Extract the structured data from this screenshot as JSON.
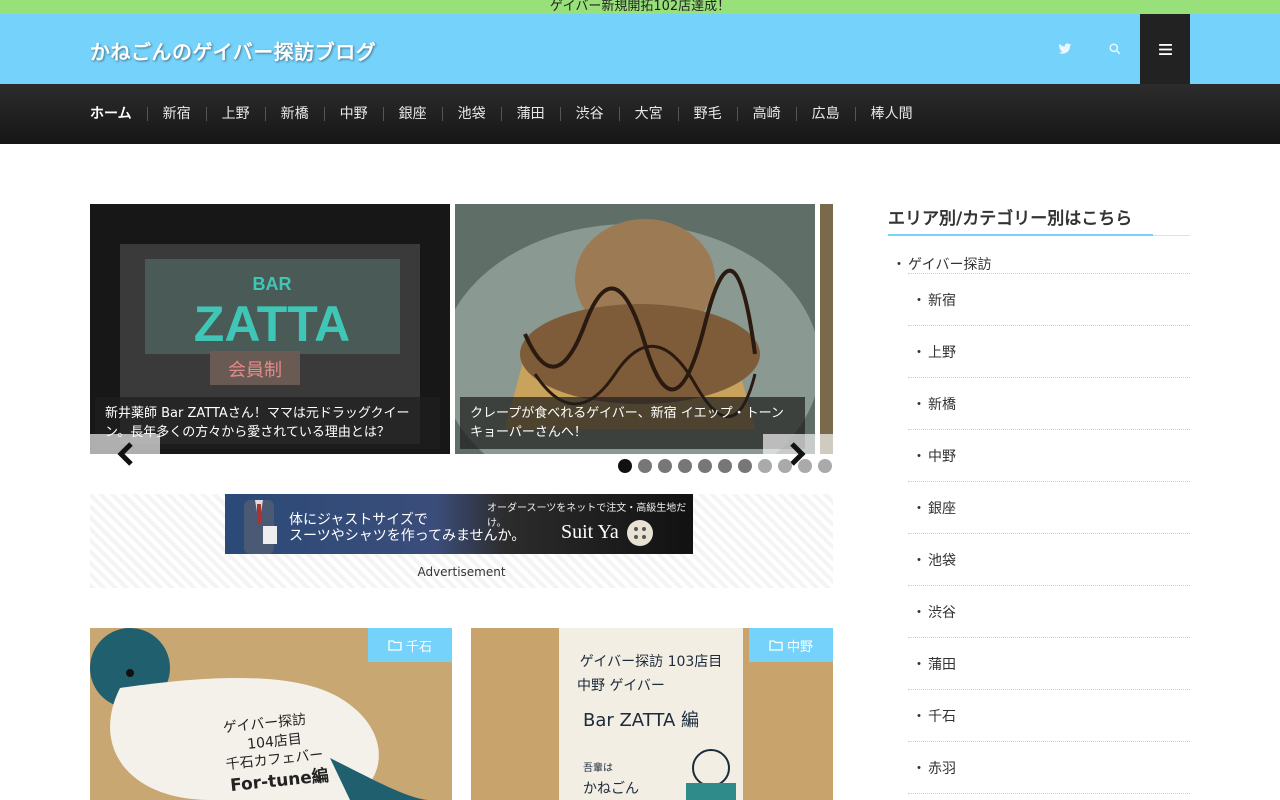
{
  "notice": {
    "text": "ゲイバー新規開拓102店達成！"
  },
  "header": {
    "site_title": "かねごんのゲイバー探訪ブログ",
    "icons": [
      "twitter-icon",
      "search-icon",
      "menu-icon"
    ]
  },
  "nav": {
    "items": [
      "ホーム",
      "新宿",
      "上野",
      "新橋",
      "中野",
      "銀座",
      "池袋",
      "蒲田",
      "渋谷",
      "大宮",
      "野毛",
      "高崎",
      "広島",
      "棒人間"
    ]
  },
  "slider": {
    "slides": [
      {
        "caption": "新井薬師 Bar ZATTAさん！ママは元ドラッグクイーン。長年多くの方々から愛されている理由とは？",
        "sign_top": "BAR",
        "sign_main": "ZATTA",
        "sign_sub": "会員制"
      },
      {
        "caption": "クレープが食べれるゲイバー、新宿 イエップ・トーンキョーパーさんへ！"
      }
    ],
    "dots": 11,
    "active_dot": 1
  },
  "ad": {
    "line1": "体にジャストサイズで",
    "line2": "スーツやシャツを作ってみませんか。",
    "top_text": "オーダースーツをネットで注文・高級生地だけ。",
    "brand": "Suit Ya",
    "label": "Advertisement"
  },
  "posts": [
    {
      "category": "千石",
      "card_lines": [
        "ゲイバー探訪",
        "104店目",
        "千石カフェバー",
        "For-tune編"
      ]
    },
    {
      "category": "中野",
      "card_lines": [
        "ゲイバー探訪 103店目",
        "中野 ゲイバー",
        "Bar ZATTA 編",
        "吾輩は",
        "かねごん"
      ]
    }
  ],
  "sidebar": {
    "title": "エリア別/カテゴリー別はこちら",
    "parent": "ゲイバー探訪",
    "children": [
      "新宿",
      "上野",
      "新橋",
      "中野",
      "銀座",
      "池袋",
      "渋谷",
      "蒲田",
      "千石",
      "赤羽"
    ]
  },
  "colors": {
    "accent": "#75d2fb",
    "notice_bg": "#98e07a",
    "nav_bg": "#1f1f1f"
  }
}
